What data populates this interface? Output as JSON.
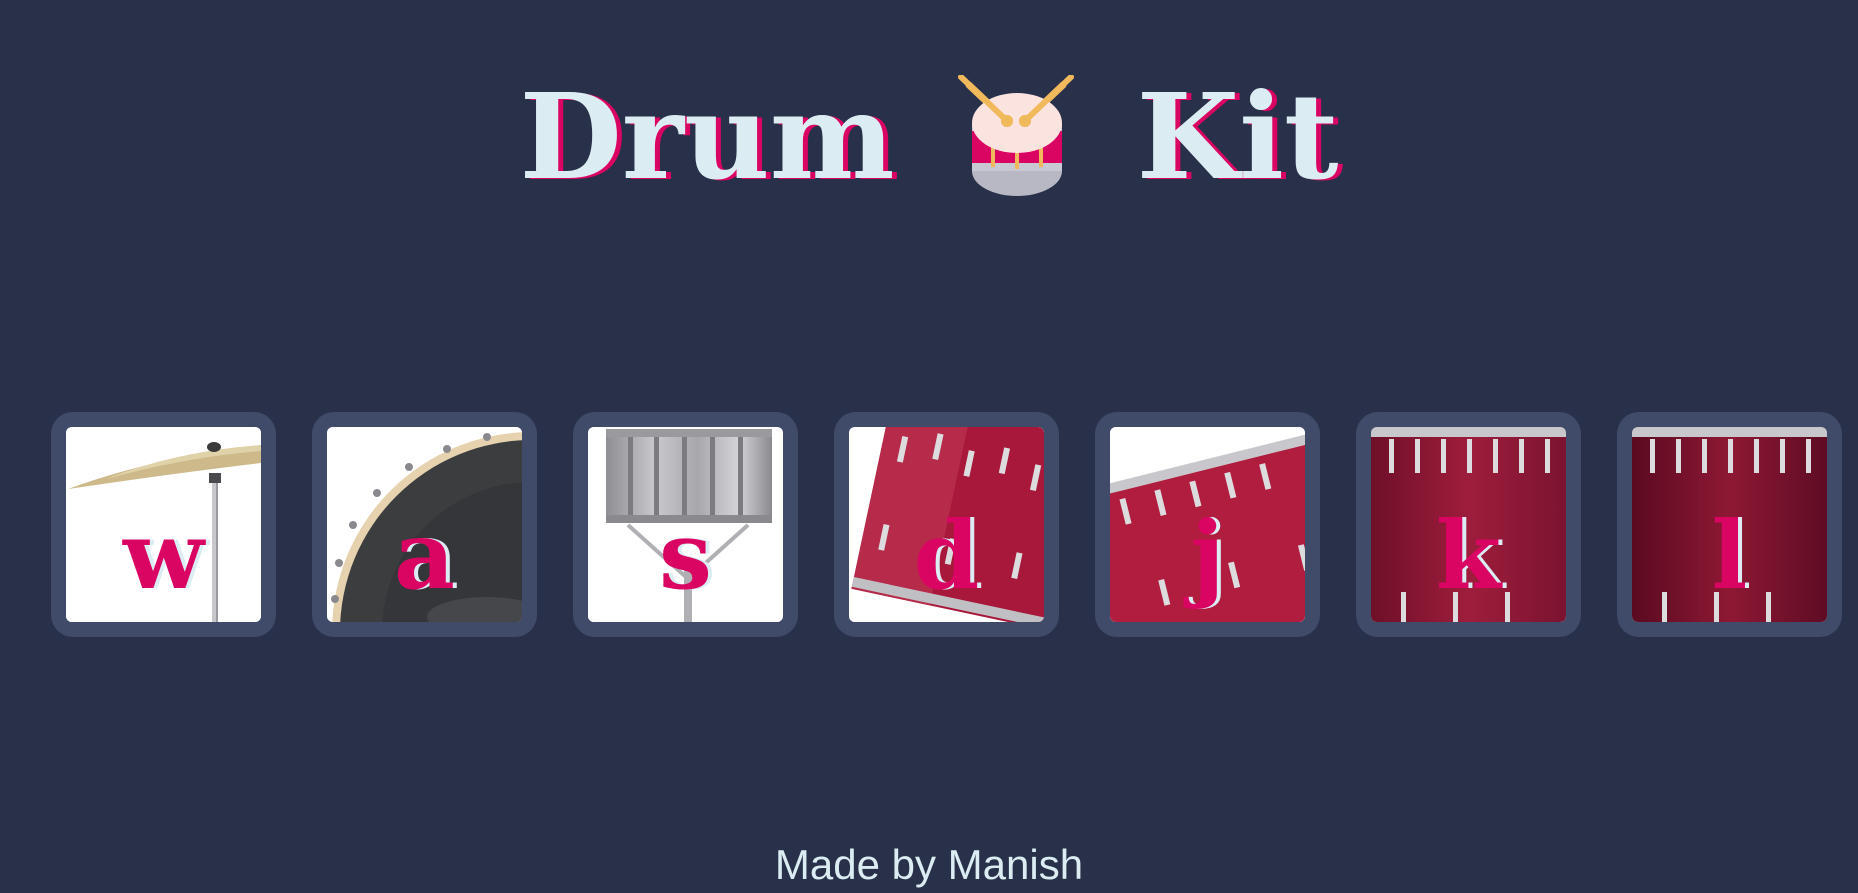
{
  "title": {
    "before": "Drum",
    "emoji_icon": "drum-icon",
    "after": "Kit"
  },
  "colors": {
    "background": "#283149",
    "tile": "#404b69",
    "title_text": "#dbedf3",
    "accent": "#da0463"
  },
  "drums": [
    {
      "key": "w",
      "image": "crash-cymbal"
    },
    {
      "key": "a",
      "image": "kick-bass"
    },
    {
      "key": "s",
      "image": "snare"
    },
    {
      "key": "d",
      "image": "tom-1"
    },
    {
      "key": "j",
      "image": "tom-2"
    },
    {
      "key": "k",
      "image": "tom-3"
    },
    {
      "key": "l",
      "image": "tom-4"
    }
  ],
  "footer": {
    "text": "Made by Manish"
  }
}
